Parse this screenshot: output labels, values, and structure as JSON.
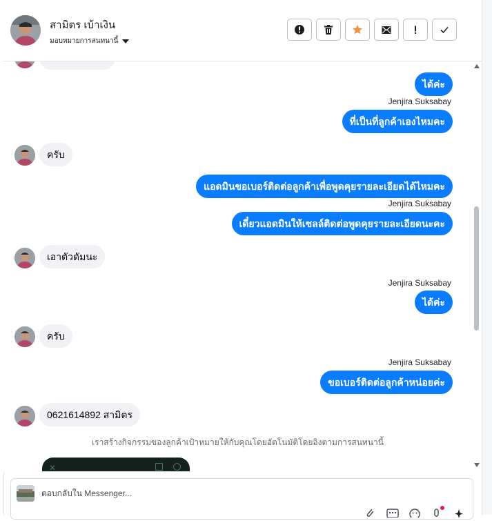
{
  "header": {
    "contact_name": "สามิตร เบ้าเงิน",
    "assign_label": "มอบหมายการสนทนานี้",
    "actions": [
      {
        "name": "spam-button",
        "icon": "alert-circle-icon"
      },
      {
        "name": "delete-button",
        "icon": "trash-icon"
      },
      {
        "name": "star-button",
        "icon": "star-icon"
      },
      {
        "name": "mark-unread-button",
        "icon": "envelope-icon"
      },
      {
        "name": "follow-up-button",
        "icon": "exclamation-icon"
      },
      {
        "name": "done-button",
        "icon": "check-icon"
      }
    ]
  },
  "colors": {
    "accent": "#0a7cff",
    "star": "#f7923b",
    "incoming_bubble": "#f0f2f5"
  },
  "messages": [
    {
      "dir": "out",
      "text": "ได้ค่ะ"
    },
    {
      "dir": "sender",
      "text": "Jenjira Suksabay"
    },
    {
      "dir": "out",
      "text": "ที่เป็นที่ลูกค้าเองไหมคะ"
    },
    {
      "dir": "in",
      "text": "ครับ"
    },
    {
      "dir": "out",
      "text": "แอดมินขอเบอร์ติดต่อลูกค้าเพื่อพูดคุยรายละเอียดได้ไหมคะ"
    },
    {
      "dir": "sender",
      "text": "Jenjira Suksabay"
    },
    {
      "dir": "out",
      "text": "เดี๋ยวแอดมินให้เซลล์ติดต่อพูดคุยรายละเอียดนะคะ"
    },
    {
      "dir": "in",
      "text": "เอาตัวดัมนะ"
    },
    {
      "dir": "sender",
      "text": "Jenjira Suksabay"
    },
    {
      "dir": "out",
      "text": "ได้ค่ะ"
    },
    {
      "dir": "in",
      "text": "ครับ"
    },
    {
      "dir": "sender",
      "text": "Jenjira Suksabay"
    },
    {
      "dir": "out",
      "text": "ขอเบอร์ติดต่อลูกค้าหน่อยค่ะ"
    },
    {
      "dir": "in",
      "text": "0621614892 สามิตร"
    }
  ],
  "system_note": "เราสร้างกิจกรรมของลูกค้าเป้าหมายให้กับคุณโดยอัตโนมัติโดยอิงตามการสนทนานี้",
  "reply": {
    "placeholder": "ตอบกลับใน Messenger...",
    "icons": [
      "attachment-icon",
      "saved-reply-icon",
      "emoji-icon",
      "mic-icon",
      "sparkle-icon"
    ]
  }
}
